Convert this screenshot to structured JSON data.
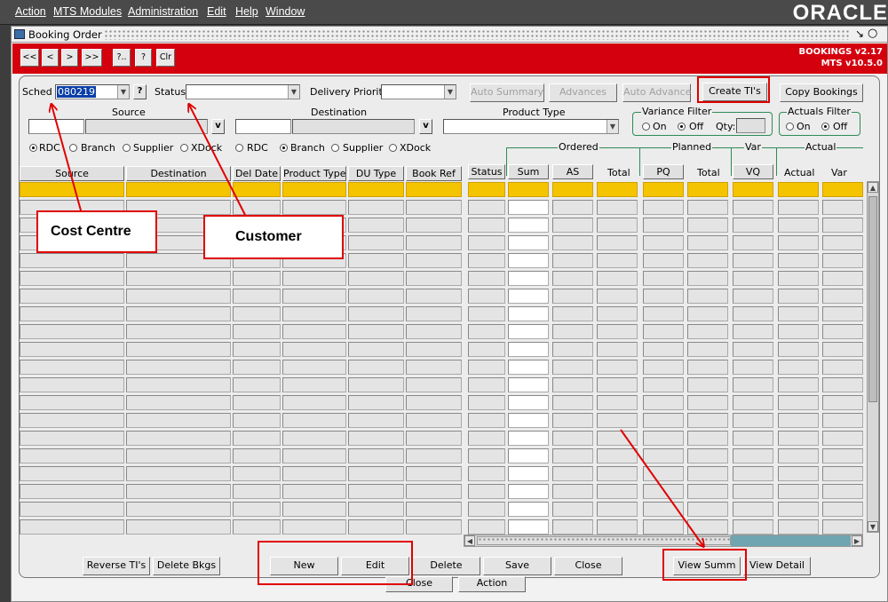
{
  "menubar": {
    "items": [
      "Action",
      "MTS Modules",
      "Administration",
      "Edit",
      "Help",
      "Window"
    ],
    "logo": "ORACLE"
  },
  "window": {
    "title": "Booking Order",
    "title_icons": [
      "minimize-icon",
      "maximize-icon"
    ],
    "toolbar": [
      "<<",
      "<",
      ">",
      ">>",
      "?..",
      "?",
      "Clr"
    ],
    "version1": "BOOKINGS v2.17",
    "version2": "MTS v10.5.0"
  },
  "filters": {
    "sched_label": "Sched",
    "sched_value": "080219",
    "sched_help": "?",
    "status_label": "Status",
    "status_value": "",
    "delivery_priority_label": "Delivery Priority",
    "delivery_priority_value": "",
    "auto_summary": "Auto Summary",
    "advances": "Advances",
    "auto_advance": "Auto Advance",
    "create_tis": "Create TI's",
    "copy_bookings": "Copy Bookings",
    "source_label": "Source",
    "destination_label": "Destination",
    "product_type_label": "Product Type",
    "lov_button": "v",
    "variance_filter_label": "Variance Filter",
    "actuals_filter_label": "Actuals Filter",
    "on_label": "On",
    "off_label": "Off",
    "qty_label": "Qty:",
    "source_types": [
      "RDC",
      "Branch",
      "Supplier",
      "XDock"
    ],
    "source_selected": "RDC",
    "dest_types": [
      "RDC",
      "Branch",
      "Supplier",
      "XDock"
    ],
    "dest_selected": "Branch",
    "variance_selected": "Off",
    "actuals_selected": "Off"
  },
  "table": {
    "left_headers": [
      "Source",
      "Destination",
      "Del Date",
      "Product Type",
      "DU Type",
      "Book Ref"
    ],
    "group_ordered": "Ordered",
    "group_planned": "Planned",
    "group_var": "Var",
    "group_actual": "Actual",
    "right_headers": [
      "Status",
      "Sum",
      "AS",
      "Total",
      "PQ",
      "Total",
      "VQ",
      "Actual",
      "Var"
    ]
  },
  "buttons": {
    "reverse_tis": "Reverse TI's",
    "delete_bkgs": "Delete Bkgs",
    "new": "New",
    "edit": "Edit",
    "delete": "Delete",
    "save": "Save",
    "close": "Close",
    "view_summ": "View Summ",
    "view_detail": "View Detail",
    "behind_close": "Close",
    "behind_action": "Action"
  },
  "annotations": {
    "cost_centre": "Cost Centre",
    "customer": "Customer"
  },
  "colors": {
    "selected_row": "#f5c400",
    "toolbar_red": "#d4000e",
    "annotation_red": "#e00000",
    "group_line": "#2e8b57"
  }
}
